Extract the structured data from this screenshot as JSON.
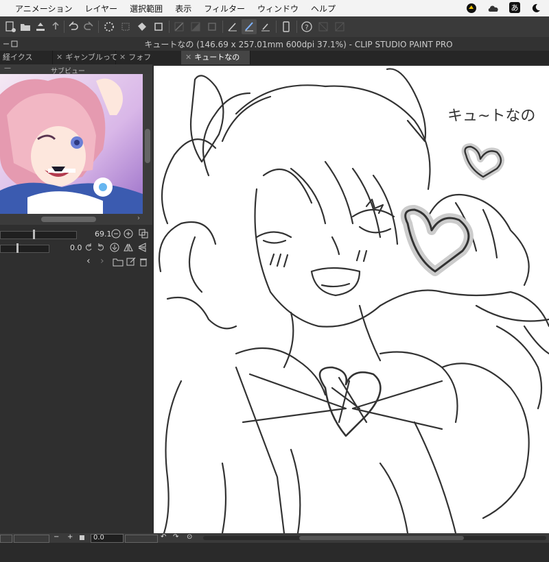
{
  "menubar": {
    "items": [
      "アニメーション",
      "レイヤー",
      "選択範囲",
      "表示",
      "フィルター",
      "ウィンドウ",
      "ヘルプ"
    ],
    "ime_label": "あ"
  },
  "window": {
    "title": "キュートなの (146.69 x 257.01mm 600dpi 37.1%) - CLIP STUDIO PAINT PRO"
  },
  "tabs": [
    {
      "label": "経イクス",
      "active": false
    },
    {
      "label": "ギャンブルって",
      "active": false
    },
    {
      "label": "フォフ",
      "active": false
    },
    {
      "label": "キュートなの",
      "active": true
    }
  ],
  "subview": {
    "header": "サブビュー",
    "zoom_value": "69.1",
    "rotation_value": "0.0"
  },
  "canvas": {
    "handwritten_text": "キュ~トなの"
  },
  "bottombar": {
    "minus": "−",
    "plus": "+",
    "value": "0.0"
  },
  "colors": {
    "accent": "#3d6fb6",
    "panel_bg": "#2f2f2f",
    "canvas_bg": "#ffffff"
  }
}
